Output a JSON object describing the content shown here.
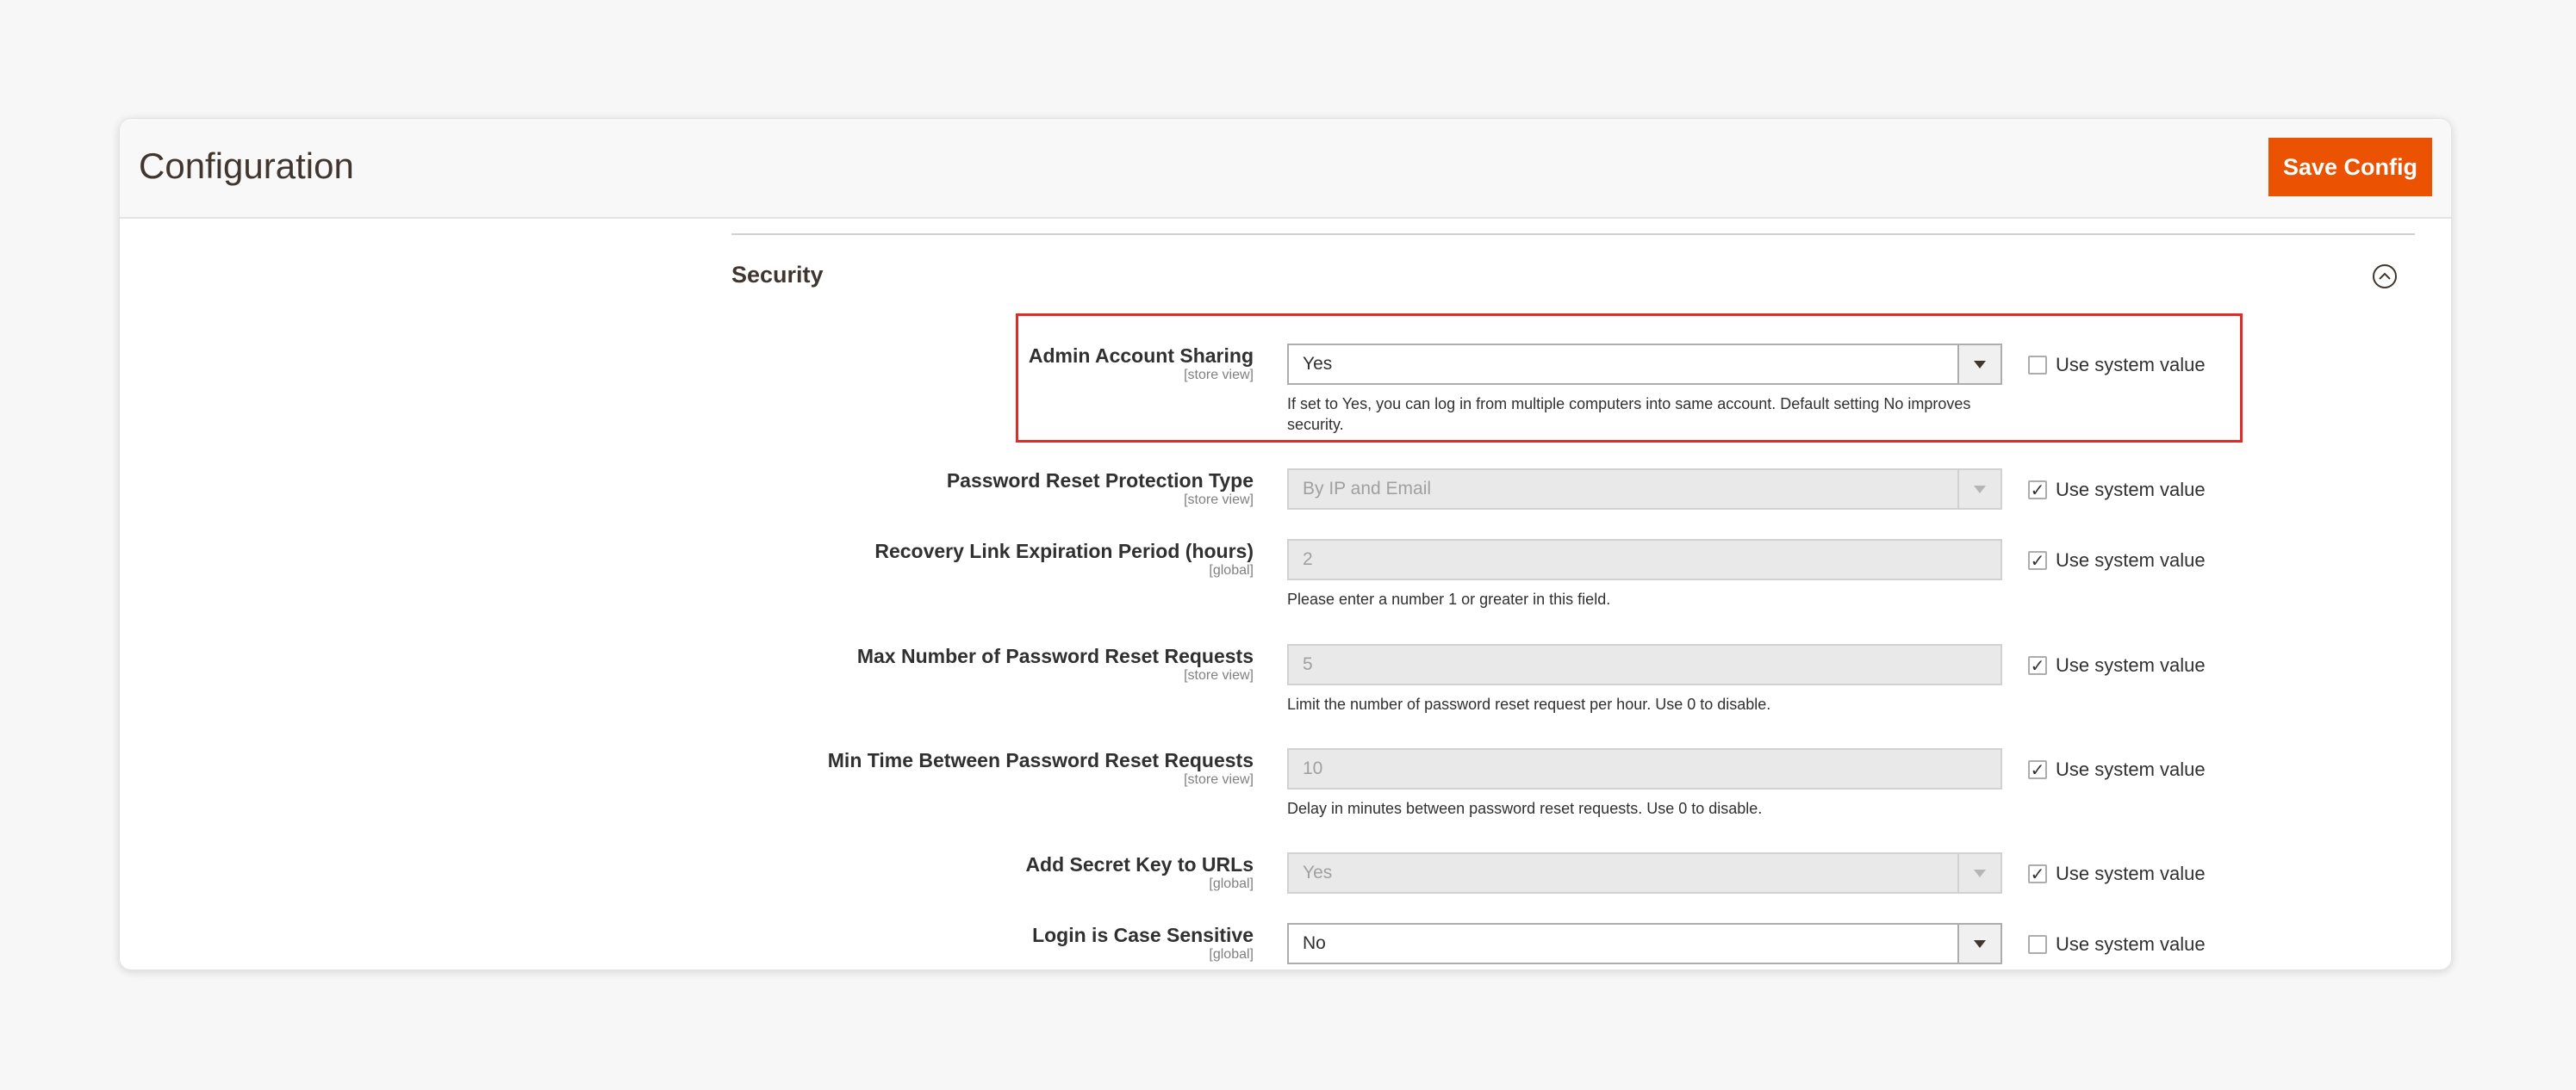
{
  "header": {
    "title": "Configuration",
    "save_label": "Save Config"
  },
  "section": {
    "title": "Security",
    "collapse_icon": "collapse-circle-chevron-up-icon"
  },
  "colors": {
    "accent": "#eb5202",
    "highlight": "#e02b27"
  },
  "fields": [
    {
      "label": "Admin Account Sharing",
      "scope": "[store view]",
      "type": "select",
      "value": "Yes",
      "disabled": false,
      "note": "If set to Yes, you can log in from multiple computers into same account. Default setting No improves security.",
      "use_system_value": false,
      "use_system_label": "Use system value"
    },
    {
      "label": "Password Reset Protection Type",
      "scope": "[store view]",
      "type": "select",
      "value": "By IP and Email",
      "disabled": true,
      "note": "",
      "use_system_value": true,
      "use_system_label": "Use system value"
    },
    {
      "label": "Recovery Link Expiration Period (hours)",
      "scope": "[global]",
      "type": "text",
      "value": "2",
      "disabled": true,
      "note": "Please enter a number 1 or greater in this field.",
      "use_system_value": true,
      "use_system_label": "Use system value"
    },
    {
      "label": "Max Number of Password Reset Requests",
      "scope": "[store view]",
      "type": "text",
      "value": "5",
      "disabled": true,
      "note": "Limit the number of password reset request per hour. Use 0 to disable.",
      "use_system_value": true,
      "use_system_label": "Use system value"
    },
    {
      "label": "Min Time Between Password Reset Requests",
      "scope": "[store view]",
      "type": "text",
      "value": "10",
      "disabled": true,
      "note": "Delay in minutes between password reset requests. Use 0 to disable.",
      "use_system_value": true,
      "use_system_label": "Use system value"
    },
    {
      "label": "Add Secret Key to URLs",
      "scope": "[global]",
      "type": "select",
      "value": "Yes",
      "disabled": true,
      "note": "",
      "use_system_value": true,
      "use_system_label": "Use system value"
    },
    {
      "label": "Login is Case Sensitive",
      "scope": "[global]",
      "type": "select",
      "value": "No",
      "disabled": false,
      "note": "",
      "use_system_value": false,
      "use_system_label": "Use system value"
    }
  ]
}
